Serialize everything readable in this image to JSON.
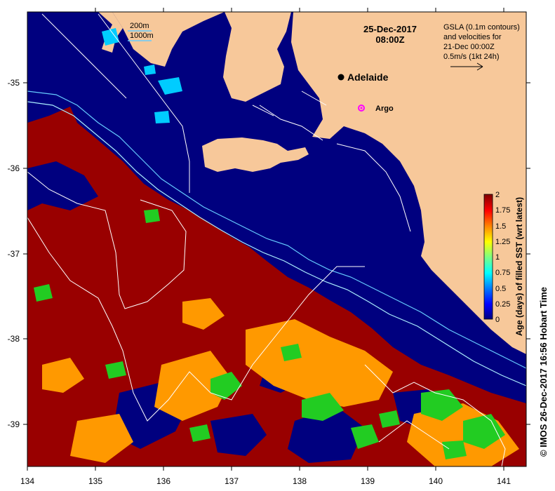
{
  "title": {
    "date": "25-Dec-2017",
    "time": "08:00Z"
  },
  "legend_contours": {
    "depth_200": "200m",
    "depth_1000": "1000m"
  },
  "gsla_note": {
    "line1": "GSLA (0.1m contours)",
    "line2": "and velocities for",
    "line3": "21-Dec 00:00Z",
    "line4": "0.5m/s (1kt 24h)"
  },
  "places": {
    "adelaide": "Adelaide",
    "argo": "Argo"
  },
  "axes": {
    "x_ticks": [
      "134",
      "135",
      "136",
      "137",
      "138",
      "139",
      "140",
      "141"
    ],
    "y_ticks": [
      "-35",
      "-36",
      "-37",
      "-38",
      "-39"
    ]
  },
  "colorbar": {
    "label": "Age (days) of filled SST (wrt latest)",
    "ticks": [
      "2",
      "1.75",
      "1.5",
      "1.25",
      "1",
      "0.75",
      "0.5",
      "0.25",
      "0"
    ],
    "stops": [
      "#00007f",
      "#0000ff",
      "#007fff",
      "#00ffff",
      "#7fff7f",
      "#ffff00",
      "#ff7f00",
      "#ff0000",
      "#7f0000"
    ]
  },
  "credit": "© IMOS 26-Dec-2017 16:56 Hobart Time",
  "colors": {
    "land": "#f7c89a",
    "ocean_recent": "#00007f",
    "age_high": "#990000",
    "age_mid": "#ff9900",
    "age_green": "#22cc22",
    "contour_200": "#66ccff",
    "contour_1000": "#aaeeff",
    "gsla_contour": "#ffffff",
    "argo_marker": "#ff00ff"
  }
}
